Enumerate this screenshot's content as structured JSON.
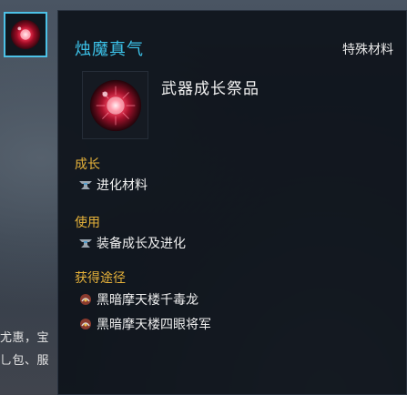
{
  "background": {
    "line1": "尤惠，宝",
    "line2": "乚包、服"
  },
  "slot": {
    "icon": "red-orb-icon"
  },
  "tooltip": {
    "title": "烛魔真气",
    "category": "特殊材料",
    "item_type": "武器成长祭品",
    "sections": [
      {
        "heading": "成长",
        "entries": [
          {
            "icon": "anvil-icon",
            "text": "进化材料"
          }
        ]
      },
      {
        "heading": "使用",
        "entries": [
          {
            "icon": "anvil-icon",
            "text": "装备成长及进化"
          }
        ]
      },
      {
        "heading": "获得途径",
        "entries": [
          {
            "icon": "dungeon-icon",
            "text": "黑暗摩天楼千毒龙"
          },
          {
            "icon": "dungeon-icon",
            "text": "黑暗摩天楼四眼将军"
          }
        ]
      }
    ]
  },
  "colors": {
    "title": "#3cc3ea",
    "section_heading": "#e6b23a",
    "slot_border": "#4cc1e6"
  }
}
